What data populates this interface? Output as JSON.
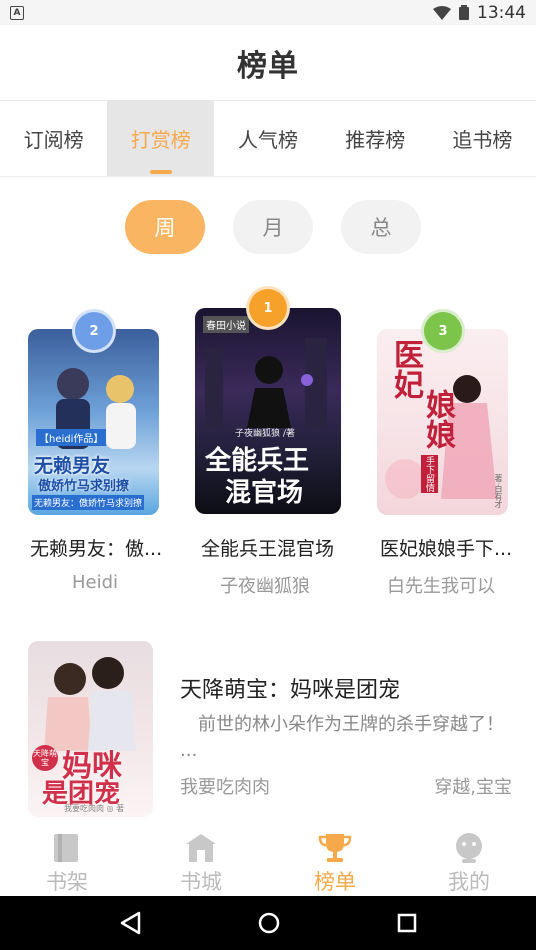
{
  "status_bar": {
    "time": "13:44"
  },
  "header": {
    "title": "榜单"
  },
  "tabs": [
    {
      "label": "订阅榜",
      "active": false
    },
    {
      "label": "打赏榜",
      "active": true
    },
    {
      "label": "人气榜",
      "active": false
    },
    {
      "label": "推荐榜",
      "active": false
    },
    {
      "label": "追书榜",
      "active": false
    }
  ],
  "periods": [
    {
      "label": "周",
      "active": true
    },
    {
      "label": "月",
      "active": false
    },
    {
      "label": "总",
      "active": false
    }
  ],
  "podium": [
    {
      "rank": "2",
      "title": "无赖男友：傲...",
      "author": "Heidi",
      "cover_text": {
        "tag": "【heidi作品】",
        "line1": "无赖男友",
        "line2": "傲娇竹马求别撩",
        "sub": "无赖男友：傲娇竹马求别撩"
      }
    },
    {
      "rank": "1",
      "title": "全能兵王混官场",
      "author": "子夜幽狐狼",
      "cover_text": {
        "publisher": "春田小说",
        "author_line": "子夜幽狐狼 /著",
        "line1": "全能兵王",
        "line2": "混官场"
      }
    },
    {
      "rank": "3",
      "title": "医妃娘娘手下...",
      "author": "白先生我可以",
      "cover_text": {
        "line1": "医妃",
        "line2": "娘娘",
        "sub": "手下留情",
        "signature": "著·白有才"
      }
    }
  ],
  "featured": {
    "title": "天降萌宝：妈咪是团宠",
    "description": "前世的林小朵作为王牌的杀手穿越了！ ...",
    "author": "我要吃肉肉",
    "tags": "穿越,宝宝",
    "cover_text": {
      "line1": "妈咪",
      "line2": "是团宠",
      "badge": "天降萌宝",
      "author_line": "我要吃肉肉 ◎ 著"
    }
  },
  "bottom_nav": [
    {
      "label": "书架",
      "icon": "bookshelf-icon",
      "active": false
    },
    {
      "label": "书城",
      "icon": "bookstore-icon",
      "active": false
    },
    {
      "label": "榜单",
      "icon": "trophy-icon",
      "active": true
    },
    {
      "label": "我的",
      "icon": "profile-icon",
      "active": false
    }
  ],
  "colors": {
    "accent": "#f6a94a",
    "rank1": "#f6a22a",
    "rank2": "#6f9ee8",
    "rank3": "#7cc44a"
  }
}
